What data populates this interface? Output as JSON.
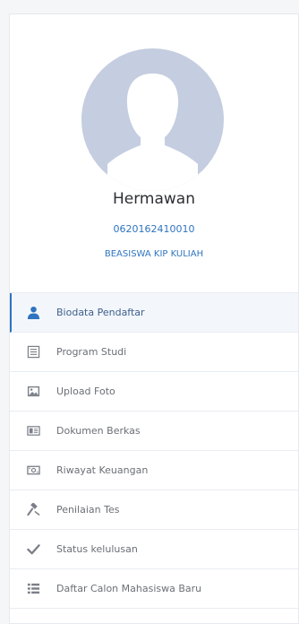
{
  "profile": {
    "name": "Hermawan",
    "nim": "0620162410010",
    "program": "BEASISWA KIP KULIAH"
  },
  "menu": {
    "items": [
      {
        "label": "Biodata Pendaftar",
        "icon": "user-icon",
        "active": true
      },
      {
        "label": "Program Studi",
        "icon": "list-icon",
        "active": false
      },
      {
        "label": "Upload Foto",
        "icon": "image-icon",
        "active": false
      },
      {
        "label": "Dokumen Berkas",
        "icon": "document-icon",
        "active": false
      },
      {
        "label": "Riwayat Keuangan",
        "icon": "money-icon",
        "active": false
      },
      {
        "label": "Penilaian Tes",
        "icon": "gavel-icon",
        "active": false
      },
      {
        "label": "Status kelulusan",
        "icon": "check-icon",
        "active": false
      },
      {
        "label": "Daftar Calon Mahasiswa Baru",
        "icon": "list-bullet-icon",
        "active": false
      }
    ]
  },
  "colors": {
    "accent": "#2f74c0",
    "icon_active": "#2f74c0",
    "icon_default": "#7a7f87",
    "avatar_bg": "#c5cde0"
  }
}
